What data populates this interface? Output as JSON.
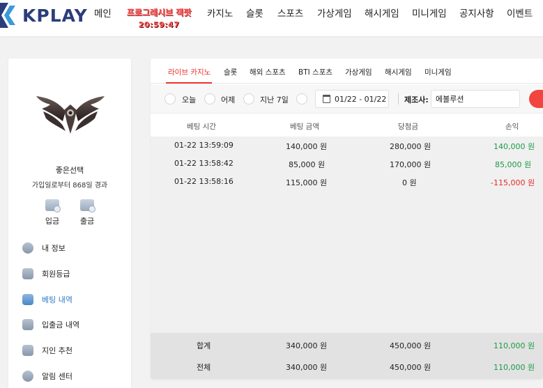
{
  "brand": {
    "logo_text": "KPLAY"
  },
  "nav": {
    "items": [
      "메인",
      "카지노",
      "슬롯",
      "스포츠",
      "가상게임",
      "해시게임",
      "미니게임",
      "공지사항",
      "이벤트"
    ],
    "progressive_jackpot": {
      "label": "프로그레시브 잭팟",
      "timer": "20:59:47"
    }
  },
  "sidebar": {
    "username": "좋은선택",
    "join_info": "가입일로부터 868일 경과",
    "deposit_label": "입금",
    "withdraw_label": "출금",
    "menu": [
      "내 정보",
      "회원등급",
      "베팅 내역",
      "입출금 내역",
      "지인 추천",
      "알림 센터"
    ],
    "active_menu": "베팅 내역"
  },
  "tabs": {
    "items": [
      "라이브 카지노",
      "슬롯",
      "해외 스포츠",
      "BTI 스포츠",
      "가상게임",
      "해시게임",
      "미니게임"
    ],
    "active": "라이브 카지노"
  },
  "filter": {
    "options": [
      "오늘",
      "어제",
      "지난 7일"
    ],
    "date_range": "01/22 - 01/22",
    "maker_label": "제조사:",
    "maker_value": "에볼루션"
  },
  "table": {
    "headers": [
      "베팅 시간",
      "베팅 금액",
      "당첨금",
      "손익"
    ],
    "rows": [
      {
        "time": "01-22 13:59:09",
        "bet": "140,000 원",
        "win": "280,000 원",
        "pl": "140,000 원",
        "pl_status": "positive"
      },
      {
        "time": "01-22 13:58:42",
        "bet": "85,000 원",
        "win": "170,000 원",
        "pl": "85,000 원",
        "pl_status": "positive"
      },
      {
        "time": "01-22 13:58:16",
        "bet": "115,000 원",
        "win": "0 원",
        "pl": "-115,000 원",
        "pl_status": "negative"
      }
    ],
    "summary": [
      {
        "label": "합계",
        "bet": "340,000 원",
        "win": "450,000 원",
        "pl": "110,000 원"
      },
      {
        "label": "전체",
        "bet": "340,000 원",
        "win": "450,000 원",
        "pl": "110,000 원"
      }
    ]
  },
  "colors": {
    "accent": "#e8322b",
    "positive": "#1a9a45",
    "negative": "#e22a2a",
    "link_active": "#2d79c7",
    "brand": "#2b3d7a"
  }
}
